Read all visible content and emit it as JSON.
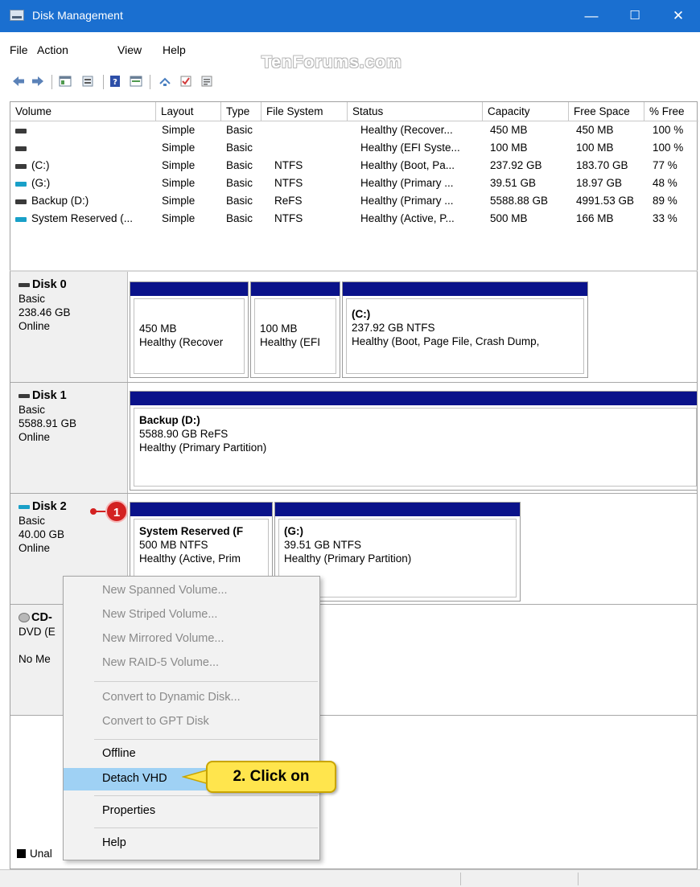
{
  "window": {
    "title": "Disk Management",
    "controls": {
      "minimize": "—",
      "maximize": "☐",
      "close": "✕"
    }
  },
  "menu": [
    "File",
    "Action",
    "View",
    "Help"
  ],
  "watermark": "TenForums.com",
  "volume_table": {
    "columns": [
      "Volume",
      "Layout",
      "Type",
      "File System",
      "Status",
      "Capacity",
      "Free Space",
      "% Free"
    ],
    "rows": [
      {
        "volume": "",
        "icon": "disk-icon",
        "layout": "Simple",
        "type": "Basic",
        "fs": "",
        "status": "Healthy (Recover...",
        "capacity": "450 MB",
        "free": "450 MB",
        "pct": "100 %"
      },
      {
        "volume": "",
        "icon": "disk-icon",
        "layout": "Simple",
        "type": "Basic",
        "fs": "",
        "status": "Healthy (EFI Syste...",
        "capacity": "100 MB",
        "free": "100 MB",
        "pct": "100 %"
      },
      {
        "volume": "(C:)",
        "icon": "disk-icon",
        "layout": "Simple",
        "type": "Basic",
        "fs": "NTFS",
        "status": "Healthy (Boot, Pa...",
        "capacity": "237.92 GB",
        "free": "183.70 GB",
        "pct": "77 %"
      },
      {
        "volume": "(G:)",
        "icon": "vhd-disk-icon",
        "layout": "Simple",
        "type": "Basic",
        "fs": "NTFS",
        "status": "Healthy (Primary ...",
        "capacity": "39.51 GB",
        "free": "18.97 GB",
        "pct": "48 %"
      },
      {
        "volume": "Backup (D:)",
        "icon": "disk-icon",
        "layout": "Simple",
        "type": "Basic",
        "fs": "ReFS",
        "status": "Healthy (Primary ...",
        "capacity": "5588.88 GB",
        "free": "4991.53 GB",
        "pct": "89 %"
      },
      {
        "volume": "System Reserved (...",
        "icon": "vhd-disk-icon",
        "layout": "Simple",
        "type": "Basic",
        "fs": "NTFS",
        "status": "Healthy (Active, P...",
        "capacity": "500 MB",
        "free": "166 MB",
        "pct": "33 %"
      }
    ]
  },
  "disks": [
    {
      "name": "Disk 0",
      "type": "Basic",
      "size": "238.46 GB",
      "state": "Online",
      "partitions": [
        {
          "title": "",
          "line1": "450 MB",
          "line2": "Healthy (Recover"
        },
        {
          "title": "",
          "line1": "100 MB",
          "line2": "Healthy (EFI"
        },
        {
          "title": "(C:)",
          "line1": "237.92 GB NTFS",
          "line2": "Healthy (Boot, Page File, Crash Dump,"
        }
      ]
    },
    {
      "name": "Disk 1",
      "type": "Basic",
      "size": "5588.91 GB",
      "state": "Online",
      "partitions": [
        {
          "title": "Backup  (D:)",
          "line1": "5588.90 GB ReFS",
          "line2": "Healthy (Primary Partition)"
        }
      ]
    },
    {
      "name": "Disk 2",
      "type": "Basic",
      "size": "40.00 GB",
      "state": "Online",
      "partitions": [
        {
          "title": "System Reserved  (F",
          "line1": "500 MB NTFS",
          "line2": "Healthy (Active, Prim"
        },
        {
          "title": "(G:)",
          "line1": "39.51 GB NTFS",
          "line2": "Healthy (Primary Partition)"
        }
      ]
    },
    {
      "name": "CD-",
      "type": "DVD (E",
      "size": "",
      "state": "No Me"
    }
  ],
  "unallocated_legend": "Unal",
  "context_menu": {
    "items": [
      {
        "label": "New Spanned Volume...",
        "enabled": false
      },
      {
        "label": "New Striped Volume...",
        "enabled": false
      },
      {
        "label": "New Mirrored Volume...",
        "enabled": false
      },
      {
        "label": "New RAID-5 Volume...",
        "enabled": false
      },
      {
        "label": "Convert to Dynamic Disk...",
        "enabled": false
      },
      {
        "label": "Convert to GPT Disk",
        "enabled": false
      },
      {
        "label": "Offline",
        "enabled": true
      },
      {
        "label": "Detach VHD",
        "enabled": true,
        "highlighted": true
      },
      {
        "label": "Properties",
        "enabled": true
      },
      {
        "label": "Help",
        "enabled": true
      }
    ]
  },
  "callouts": {
    "step1": "1",
    "step2": "2. Click on"
  },
  "colors": {
    "titlebar": "#1a6fd0",
    "partition_bar": "#0a128a",
    "highlight": "#9fd1f4",
    "callout_red": "#d32121",
    "callout_yellow": "#ffe54d"
  }
}
